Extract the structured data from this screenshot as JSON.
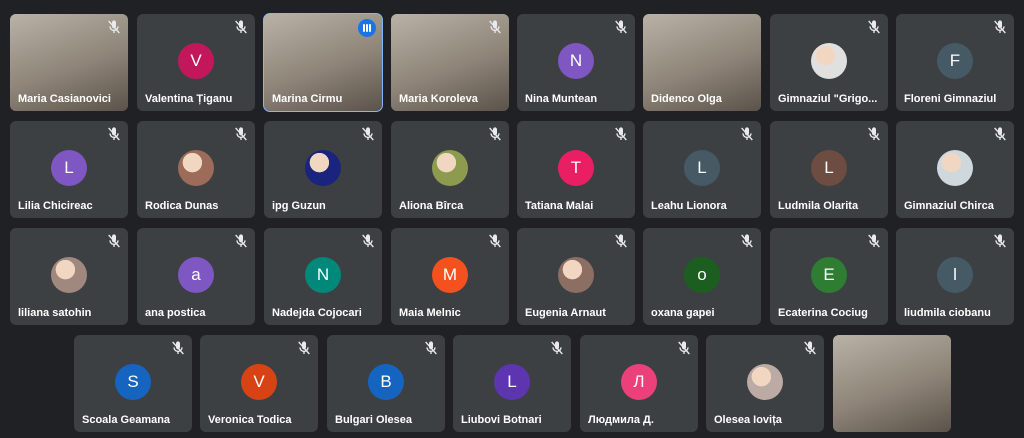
{
  "participants": [
    {
      "name": "Maria Casianovici",
      "type": "video",
      "muted": true
    },
    {
      "name": "Valentina Țiganu",
      "type": "avatar",
      "initial": "V",
      "color": "#c2185b",
      "muted": true
    },
    {
      "name": "Marina Cirmu",
      "type": "video",
      "muted": false,
      "speaking": true
    },
    {
      "name": "Maria Koroleva",
      "type": "video",
      "muted": true
    },
    {
      "name": "Nina Muntean",
      "type": "avatar",
      "initial": "N",
      "color": "#7e57c2",
      "muted": true
    },
    {
      "name": "Didenco Olga",
      "type": "video",
      "muted": false
    },
    {
      "name": "Gimnaziul \"Grigo...",
      "type": "avatar",
      "initial": "",
      "color": "#e0e0e0",
      "muted": true
    },
    {
      "name": "Floreni Gimnaziul",
      "type": "avatar",
      "initial": "F",
      "color": "#455a64",
      "muted": true
    },
    {
      "name": "Lilia Chicireac",
      "type": "avatar",
      "initial": "L",
      "color": "#7e57c2",
      "muted": true
    },
    {
      "name": "Rodica Dunas",
      "type": "avatar",
      "initial": "",
      "color": "#9c6b5a",
      "muted": true
    },
    {
      "name": "ipg Guzun",
      "type": "avatar",
      "initial": "",
      "color": "#1a237e",
      "muted": true
    },
    {
      "name": "Aliona Bîrca",
      "type": "avatar",
      "initial": "",
      "color": "#8d9b4f",
      "muted": true
    },
    {
      "name": "Tatiana Malai",
      "type": "avatar",
      "initial": "T",
      "color": "#e91e63",
      "muted": true
    },
    {
      "name": "Leahu Lionora",
      "type": "avatar",
      "initial": "L",
      "color": "#455a64",
      "muted": true
    },
    {
      "name": "Ludmila Olarita",
      "type": "avatar",
      "initial": "L",
      "color": "#6d4c41",
      "muted": true
    },
    {
      "name": "Gimnaziul Chirca",
      "type": "avatar",
      "initial": "",
      "color": "#cfd8dc",
      "muted": true
    },
    {
      "name": "liliana satohin",
      "type": "avatar",
      "initial": "",
      "color": "#a1887f",
      "muted": true
    },
    {
      "name": "ana postica",
      "type": "avatar",
      "initial": "a",
      "color": "#7e57c2",
      "muted": true
    },
    {
      "name": "Nadejda Cojocari",
      "type": "avatar",
      "initial": "N",
      "color": "#00897b",
      "muted": true
    },
    {
      "name": "Maia Melnic",
      "type": "avatar",
      "initial": "M",
      "color": "#f4511e",
      "muted": true
    },
    {
      "name": "Eugenia Arnaut",
      "type": "avatar",
      "initial": "",
      "color": "#8d6e63",
      "muted": true
    },
    {
      "name": "oxana gapei",
      "type": "avatar",
      "initial": "o",
      "color": "#1b5e20",
      "muted": true
    },
    {
      "name": "Ecaterina Cociug",
      "type": "avatar",
      "initial": "E",
      "color": "#2e7d32",
      "muted": true
    },
    {
      "name": "liudmila ciobanu",
      "type": "avatar",
      "initial": "l",
      "color": "#455a64",
      "muted": true
    },
    {
      "name": "Scoala Geamana",
      "type": "avatar",
      "initial": "S",
      "color": "#1565c0",
      "muted": true
    },
    {
      "name": "Veronica Todica",
      "type": "avatar",
      "initial": "V",
      "color": "#d84315",
      "muted": true
    },
    {
      "name": "Bulgari Olesea",
      "type": "avatar",
      "initial": "B",
      "color": "#1565c0",
      "muted": true
    },
    {
      "name": "Liubovi Botnari",
      "type": "avatar",
      "initial": "L",
      "color": "#5e35b1",
      "muted": true
    },
    {
      "name": "Людмила Д.",
      "type": "avatar",
      "initial": "Л",
      "color": "#ec407a",
      "muted": true
    },
    {
      "name": "Olesea Iovița",
      "type": "avatar",
      "initial": "",
      "color": "#bcaaa4",
      "muted": true
    },
    {
      "name": "",
      "type": "video",
      "muted": false
    }
  ]
}
